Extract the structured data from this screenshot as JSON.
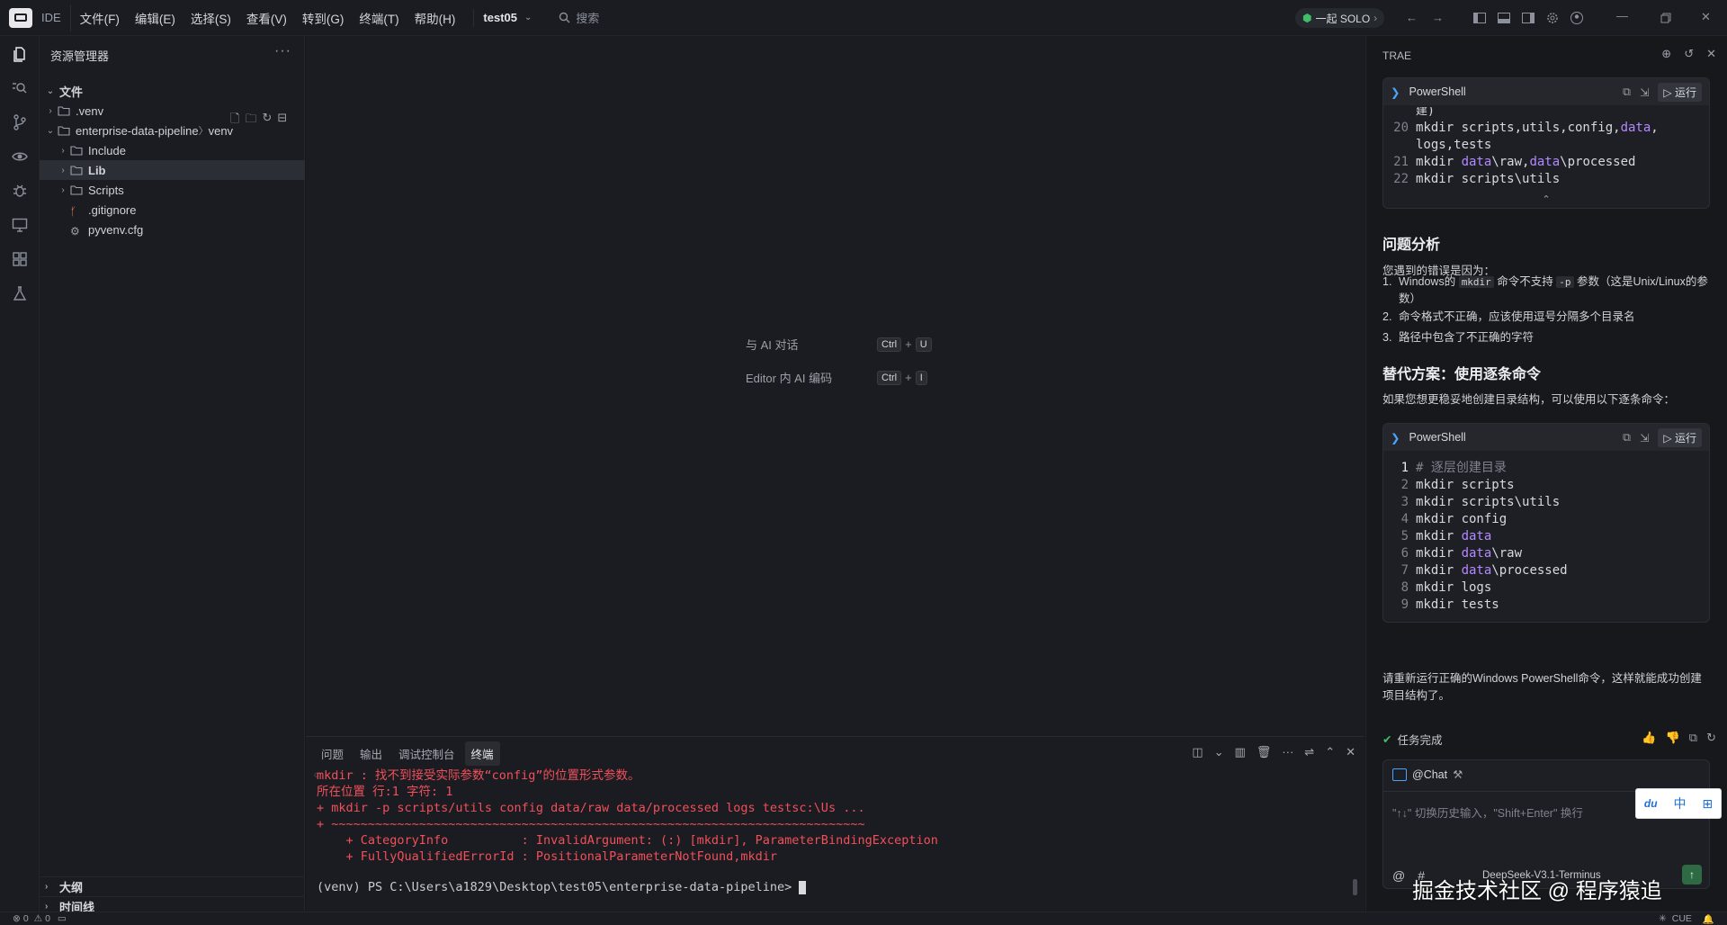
{
  "titlebar": {
    "ide_label": "IDE",
    "menu": [
      "文件(F)",
      "编辑(E)",
      "选择(S)",
      "查看(V)",
      "转到(G)",
      "终端(T)",
      "帮助(H)"
    ],
    "project": "test05",
    "search_placeholder": "搜索",
    "solo_label": "一起 SOLO"
  },
  "sidebar": {
    "title": "资源管理器",
    "files_header": "文件",
    "tree": [
      {
        "label": ".venv",
        "type": "folder",
        "depth": 0
      },
      {
        "label": "enterprise-data-pipeline",
        "suffix": "venv",
        "type": "folder-open",
        "depth": 0
      },
      {
        "label": "Include",
        "type": "folder",
        "depth": 1
      },
      {
        "label": "Lib",
        "type": "folder",
        "depth": 1,
        "selected": true
      },
      {
        "label": "Scripts",
        "type": "folder",
        "depth": 1
      },
      {
        "label": ".gitignore",
        "type": "git-file",
        "depth": 1
      },
      {
        "label": "pyvenv.cfg",
        "type": "gear-file",
        "depth": 1
      }
    ],
    "outline": "大纲",
    "timeline": "时间线"
  },
  "editor": {
    "hint_chat": "与 AI 对话",
    "hint_chat_keys": [
      "Ctrl",
      "U"
    ],
    "hint_inline": "Editor 内 AI 编码",
    "hint_inline_keys": [
      "Ctrl",
      "I"
    ]
  },
  "panel": {
    "tabs": [
      "问题",
      "输出",
      "调试控制台",
      "终端"
    ],
    "active_tab": "终端",
    "terminal_lines": [
      "mkdir : 找不到接受实际参数“config”的位置形式参数。",
      "所在位置 行:1 字符: 1",
      "+ mkdir -p scripts/utils config data/raw data/processed logs testsc:\\Us ...",
      "+ ~~~~~~~~~~~~~~~~~~~~~~~~~~~~~~~~~~~~~~~~~~~~~~~~~~~~~~~~~~~~~~~~~~~~~~~~~",
      "    + CategoryInfo          : InvalidArgument: (:) [mkdir], ParameterBindingException",
      "    + FullyQualifiedErrorId : PositionalParameterNotFound,mkdir"
    ],
    "prompt": "(venv) PS C:\\Users\\a1829\\Desktop\\test05\\enterprise-data-pipeline> "
  },
  "chat": {
    "title": "TRAE",
    "code1": {
      "lang": "PowerShell",
      "run": "运行",
      "partial": "建)",
      "lines": [
        {
          "n": "20",
          "parts": [
            [
              "mkdir scripts,utils,config,",
              ""
            ],
            [
              "data",
              "kw"
            ],
            [
              ",",
              ""
            ]
          ]
        },
        {
          "n": "",
          "parts": [
            [
              "logs,tests",
              ""
            ]
          ]
        },
        {
          "n": "21",
          "parts": [
            [
              "mkdir ",
              ""
            ],
            [
              "data",
              "kw"
            ],
            [
              "\\raw,",
              ""
            ],
            [
              "data",
              "kw"
            ],
            [
              "\\processed",
              ""
            ]
          ]
        },
        {
          "n": "22",
          "parts": [
            [
              "mkdir scripts\\utils",
              ""
            ]
          ]
        }
      ]
    },
    "h1": "问题分析",
    "p1": "您遇到的错误是因为：",
    "list": [
      {
        "n": "1.",
        "pre": "Windows的 ",
        "code": "mkdir",
        "mid": " 命令不支持 ",
        "code2": "-p",
        "post": " 参数（这是Unix/Linux的参数）"
      },
      {
        "n": "2.",
        "pre": "命令格式不正确，应该使用逗号分隔多个目录名"
      },
      {
        "n": "3.",
        "pre": "路径中包含了不正确的字符"
      }
    ],
    "h2": "替代方案：使用逐条命令",
    "p2": "如果您想更稳妥地创建目录结构，可以使用以下逐条命令：",
    "code2": {
      "lang": "PowerShell",
      "run": "运行",
      "lines": [
        {
          "n": "1",
          "parts": [
            [
              "# 逐层创建目录",
              "cm"
            ]
          ]
        },
        {
          "n": "2",
          "parts": [
            [
              "mkdir scripts",
              ""
            ]
          ]
        },
        {
          "n": "3",
          "parts": [
            [
              "mkdir scripts\\utils",
              ""
            ]
          ]
        },
        {
          "n": "4",
          "parts": [
            [
              "mkdir config",
              ""
            ]
          ]
        },
        {
          "n": "5",
          "parts": [
            [
              "mkdir ",
              ""
            ],
            [
              "data",
              "kw"
            ]
          ]
        },
        {
          "n": "6",
          "parts": [
            [
              "mkdir ",
              ""
            ],
            [
              "data",
              "kw"
            ],
            [
              "\\raw",
              ""
            ]
          ]
        },
        {
          "n": "7",
          "parts": [
            [
              "mkdir ",
              ""
            ],
            [
              "data",
              "kw"
            ],
            [
              "\\processed",
              ""
            ]
          ]
        },
        {
          "n": "8",
          "parts": [
            [
              "mkdir logs",
              ""
            ]
          ]
        },
        {
          "n": "9",
          "parts": [
            [
              "mkdir tests",
              ""
            ]
          ]
        }
      ]
    },
    "p3": "请重新运行正确的Windows PowerShell命令，这样就能成功创建项目结构了。",
    "task_done": "任务完成",
    "input_at": "@Chat",
    "input_placeholder": "\"↑↓\" 切换历史输入，\"Shift+Enter\" 换行",
    "model": "DeepSeek-V3.1-Terminus"
  },
  "ime": {
    "label1": "du",
    "label2": "中"
  },
  "watermark": "掘金技术社区 @ 程序猿追",
  "status": {
    "errors": "0",
    "warnings": "0",
    "right": "CUE"
  }
}
